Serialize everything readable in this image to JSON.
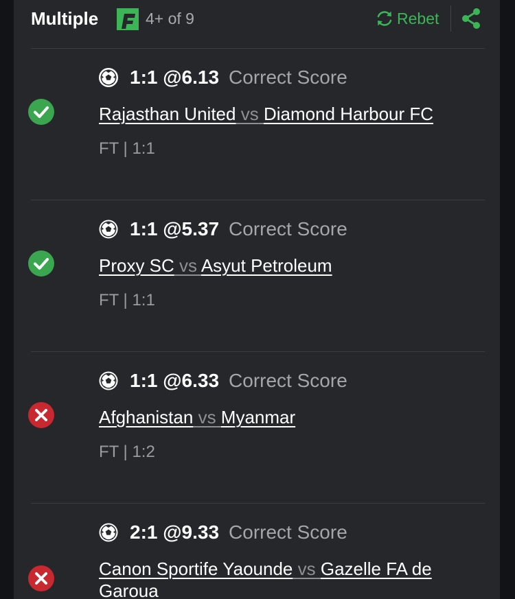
{
  "header": {
    "title": "Multiple",
    "count": "4+ of 9",
    "rebet_label": "Rebet"
  },
  "colors": {
    "accent": "#3cb556",
    "won": "#3aa650",
    "lost": "#c8282f",
    "panel": "#26272b",
    "muted": "#a5a6aa"
  },
  "bets": [
    {
      "status": "won",
      "pick": "1:1 @6.13",
      "market": "Correct Score",
      "home": "Rajasthan United",
      "vs": "vs",
      "away": "Diamond Harbour FC",
      "result": "FT | 1:1"
    },
    {
      "status": "won",
      "pick": "1:1 @5.37",
      "market": "Correct Score",
      "home": "Proxy SC",
      "vs": "vs",
      "away": "Asyut Petroleum",
      "result": "FT | 1:1"
    },
    {
      "status": "lost",
      "pick": "1:1 @6.33",
      "market": "Correct Score",
      "home": "Afghanistan",
      "vs": "vs",
      "away": "Myanmar",
      "result": "FT | 1:2"
    },
    {
      "status": "lost",
      "pick": "2:1 @9.33",
      "market": "Correct Score",
      "home": "Canon Sportife Yaounde",
      "vs": "vs",
      "away": "Gazelle FA de Garoua",
      "result": ""
    }
  ]
}
